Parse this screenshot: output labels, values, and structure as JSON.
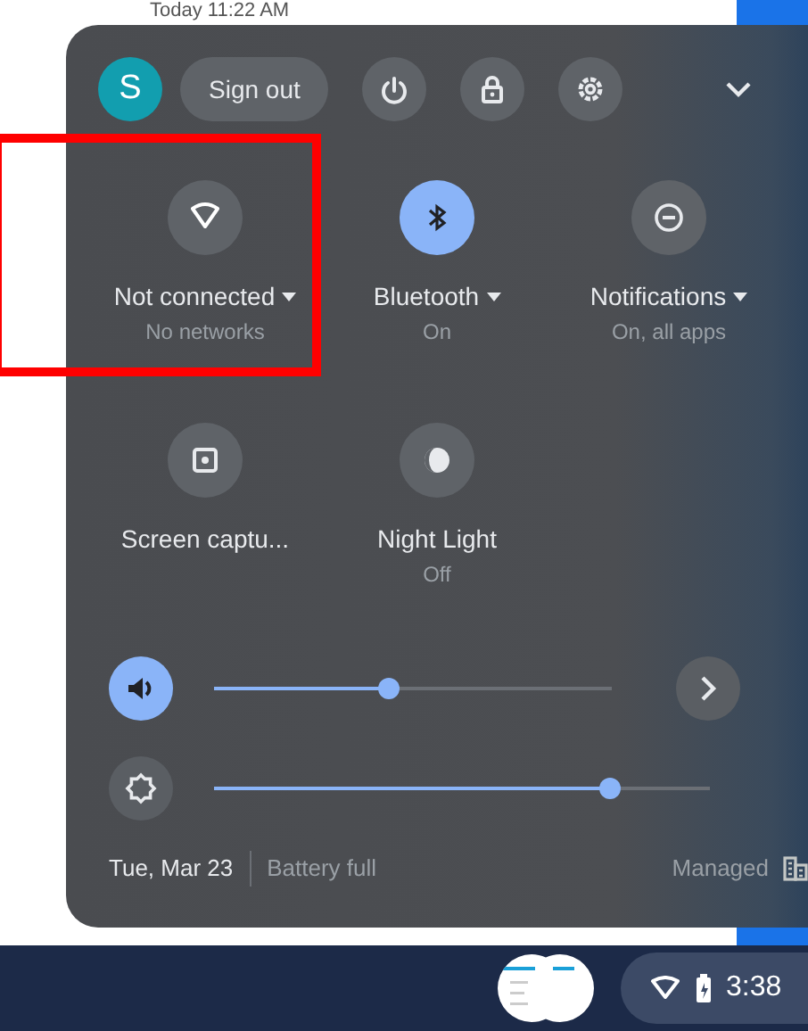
{
  "background": {
    "notification_time": "Today 11:22 AM"
  },
  "header": {
    "avatar_letter": "S",
    "sign_out": "Sign out"
  },
  "tiles": [
    {
      "label": "Not connected",
      "sublabel": "No networks",
      "on": false,
      "dropdown": true,
      "highlighted": true
    },
    {
      "label": "Bluetooth",
      "sublabel": "On",
      "on": true,
      "dropdown": true,
      "highlighted": false
    },
    {
      "label": "Notifications",
      "sublabel": "On, all apps",
      "on": false,
      "dropdown": true,
      "highlighted": false
    },
    {
      "label": "Screen captu...",
      "on": false,
      "dropdown": false,
      "highlighted": false
    },
    {
      "label": "Night Light",
      "sublabel": "Off",
      "on": false,
      "dropdown": false,
      "highlighted": false
    }
  ],
  "sliders": [
    {
      "kind": "volume",
      "level": 0.44,
      "on": true,
      "detail": true
    },
    {
      "kind": "brightness",
      "level": 0.8,
      "on": false,
      "detail": false
    }
  ],
  "footer": {
    "date": "Tue, Mar 23",
    "battery": "Battery full",
    "managed": "Managed"
  },
  "shelf": {
    "time": "3:38"
  }
}
